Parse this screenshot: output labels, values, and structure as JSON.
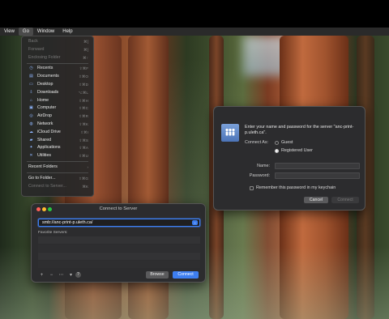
{
  "menubar": {
    "items": [
      {
        "label": "View",
        "active": false
      },
      {
        "label": "Go",
        "active": true
      },
      {
        "label": "Window",
        "active": false
      },
      {
        "label": "Help",
        "active": false
      }
    ]
  },
  "go_menu": {
    "items": [
      {
        "label": "Back",
        "shortcut": "⌘[",
        "icon": "",
        "disabled": true
      },
      {
        "label": "Forward",
        "shortcut": "⌘]",
        "icon": "",
        "disabled": true
      },
      {
        "label": "Enclosing Folder",
        "shortcut": "⌘↑",
        "icon": "",
        "disabled": true
      },
      {
        "sep": true
      },
      {
        "label": "Recents",
        "shortcut": "⇧⌘F",
        "icon": "clock-icon"
      },
      {
        "label": "Documents",
        "shortcut": "⇧⌘O",
        "icon": "document-icon"
      },
      {
        "label": "Desktop",
        "shortcut": "⇧⌘D",
        "icon": "desktop-icon"
      },
      {
        "label": "Downloads",
        "shortcut": "⌥⌘L",
        "icon": "download-icon"
      },
      {
        "label": "Home",
        "shortcut": "⇧⌘H",
        "icon": "home-icon"
      },
      {
        "label": "Computer",
        "shortcut": "⇧⌘C",
        "icon": "computer-icon"
      },
      {
        "label": "AirDrop",
        "shortcut": "⇧⌘R",
        "icon": "airdrop-icon"
      },
      {
        "label": "Network",
        "shortcut": "⇧⌘K",
        "icon": "network-icon"
      },
      {
        "label": "iCloud Drive",
        "shortcut": "⇧⌘I",
        "icon": "cloud-icon"
      },
      {
        "label": "Shared",
        "shortcut": "⇧⌘S",
        "icon": "shared-folder-icon"
      },
      {
        "label": "Applications",
        "shortcut": "⇧⌘A",
        "icon": "applications-icon"
      },
      {
        "label": "Utilities",
        "shortcut": "⇧⌘U",
        "icon": "utilities-icon"
      },
      {
        "sep": true
      },
      {
        "label": "Recent Folders",
        "shortcut": "›",
        "icon": ""
      },
      {
        "sep": true
      },
      {
        "label": "Go to Folder...",
        "shortcut": "⇧⌘G",
        "icon": ""
      },
      {
        "label": "Connect to Server...",
        "shortcut": "⌘K",
        "icon": "",
        "disabled": true
      }
    ]
  },
  "connect_window": {
    "title": "Connect to Server",
    "address": "smb://anc-print-p.uleth.ca/",
    "favorites_label": "Favorite Servers:",
    "tools": [
      "+",
      "−",
      "⋯",
      "▾"
    ],
    "help": "?",
    "browse_label": "Browse",
    "connect_label": "Connect"
  },
  "login_dialog": {
    "prompt": "Enter your name and password for the server \"anc-print-p.uleth.ca\".",
    "connect_as_label": "Connect As:",
    "guest_label": "Guest",
    "registered_label": "Registered User",
    "selected": "Registered User",
    "name_label": "Name:",
    "password_label": "Password:",
    "remember_label": "Remember this password in my keychain",
    "cancel_label": "Cancel",
    "connect_label": "Connect"
  },
  "colors": {
    "accent": "#3d7ef0",
    "menu_bg": "#282828",
    "window_bg": "#2c2c2e"
  }
}
